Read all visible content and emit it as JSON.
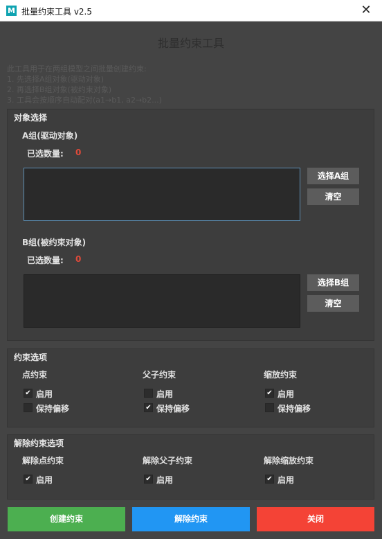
{
  "window": {
    "app_icon_letter": "M",
    "title": "批量约束工具 v2.5",
    "close_symbol": "✕"
  },
  "main_title": "批量约束工具",
  "description": [
    "此工具用于在两组模型之间批量创建约束:",
    "1. 先选择A组对象(驱动对象)",
    "2. 再选择B组对象(被约束对象)",
    "3. 工具会按顺序自动配对(a1→b1, a2→b2...)"
  ],
  "object_selection": {
    "title": "对象选择",
    "group_a": {
      "title": "A组(驱动对象)",
      "count_label": "已选数量:",
      "count": "0",
      "select_button": "选择A组",
      "clear_button": "清空"
    },
    "group_b": {
      "title": "B组(被约束对象)",
      "count_label": "已选数量:",
      "count": "0",
      "select_button": "选择B组",
      "clear_button": "清空"
    }
  },
  "constraint_options": {
    "title": "约束选项",
    "point": {
      "title": "点约束",
      "enable": "启用",
      "enable_checked": true,
      "offset": "保持偏移",
      "offset_checked": false
    },
    "parent": {
      "title": "父子约束",
      "enable": "启用",
      "enable_checked": false,
      "offset": "保持偏移",
      "offset_checked": true
    },
    "scale": {
      "title": "缩放约束",
      "enable": "启用",
      "enable_checked": true,
      "offset": "保持偏移",
      "offset_checked": false
    }
  },
  "remove_options": {
    "title": "解除约束选项",
    "point": {
      "title": "解除点约束",
      "enable": "启用",
      "checked": true
    },
    "parent": {
      "title": "解除父子约束",
      "enable": "启用",
      "checked": true
    },
    "scale": {
      "title": "解除缩放约束",
      "enable": "启用",
      "checked": true
    }
  },
  "buttons": {
    "create": "创建约束",
    "remove": "解除约束",
    "close": "关闭"
  },
  "colors": {
    "create": "#4caf50",
    "remove": "#2196f3",
    "close": "#f44336",
    "count_value": "#e04a3a",
    "focus_border": "#5d8fb5"
  },
  "icons": {
    "checkmark": "✔"
  }
}
